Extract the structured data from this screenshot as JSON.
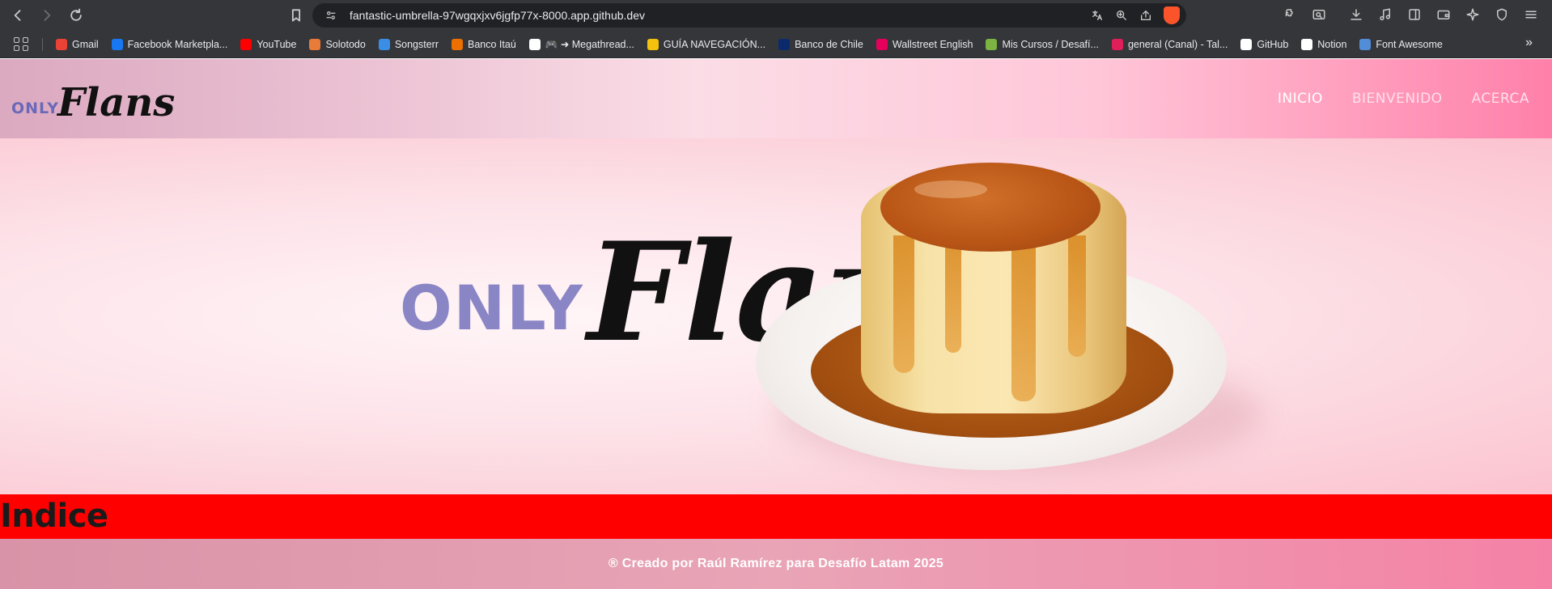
{
  "browser": {
    "url": "fantastic-umbrella-97wgqxjxv6jgfp77x-8000.app.github.dev",
    "bookmarks": [
      {
        "label": "Gmail",
        "color": "#ea4335"
      },
      {
        "label": "Facebook Marketpla...",
        "color": "#1877f2"
      },
      {
        "label": "YouTube",
        "color": "#ff0000"
      },
      {
        "label": "Solotodo",
        "color": "#e87a3a"
      },
      {
        "label": "Songsterr",
        "color": "#3a8ee6"
      },
      {
        "label": "Banco Itaú",
        "color": "#ec7000"
      },
      {
        "label": "🎮 ➜ Megathread...",
        "color": "#ffffff"
      },
      {
        "label": "GUÍA NAVEGACIÓN...",
        "color": "#f4c20d"
      },
      {
        "label": "Banco de Chile",
        "color": "#0a2a6b"
      },
      {
        "label": "Wallstreet English",
        "color": "#e6005c"
      },
      {
        "label": "Mis Cursos / Desafí...",
        "color": "#7cb342"
      },
      {
        "label": "general (Canal) - Tal...",
        "color": "#e01e5a"
      },
      {
        "label": "GitHub",
        "color": "#ffffff"
      },
      {
        "label": "Notion",
        "color": "#ffffff"
      },
      {
        "label": "Font Awesome",
        "color": "#528dd7"
      }
    ],
    "more_label": "»"
  },
  "site": {
    "logo_only": "ONLY",
    "logo_flans": "Flans",
    "nav": [
      "INICIO",
      "BIENVENIDO",
      "ACERCA"
    ],
    "hero_only": "ONLY",
    "hero_flans": "Flans",
    "indice_title": "Indice",
    "footer_text": "®  Creado por Raúl Ramírez para Desafío Latam 2025"
  }
}
